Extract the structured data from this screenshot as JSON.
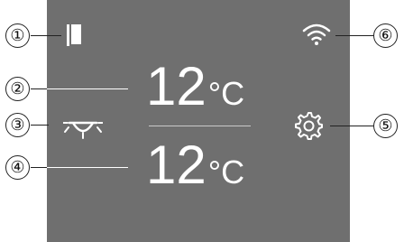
{
  "callouts": {
    "c1": "①",
    "c2": "②",
    "c3": "③",
    "c4": "④",
    "c5": "⑤",
    "c6": "⑥"
  },
  "display": {
    "fridge_temp": "12",
    "freezer_temp": "12",
    "unit": "°C"
  },
  "icons": {
    "door": "door-icon",
    "light": "light-icon",
    "wifi": "wifi-icon",
    "settings": "gear-icon"
  },
  "colors": {
    "screen_background": "#6f6f6f",
    "foreground": "#ffffff",
    "divider": "#c9c9c9"
  }
}
